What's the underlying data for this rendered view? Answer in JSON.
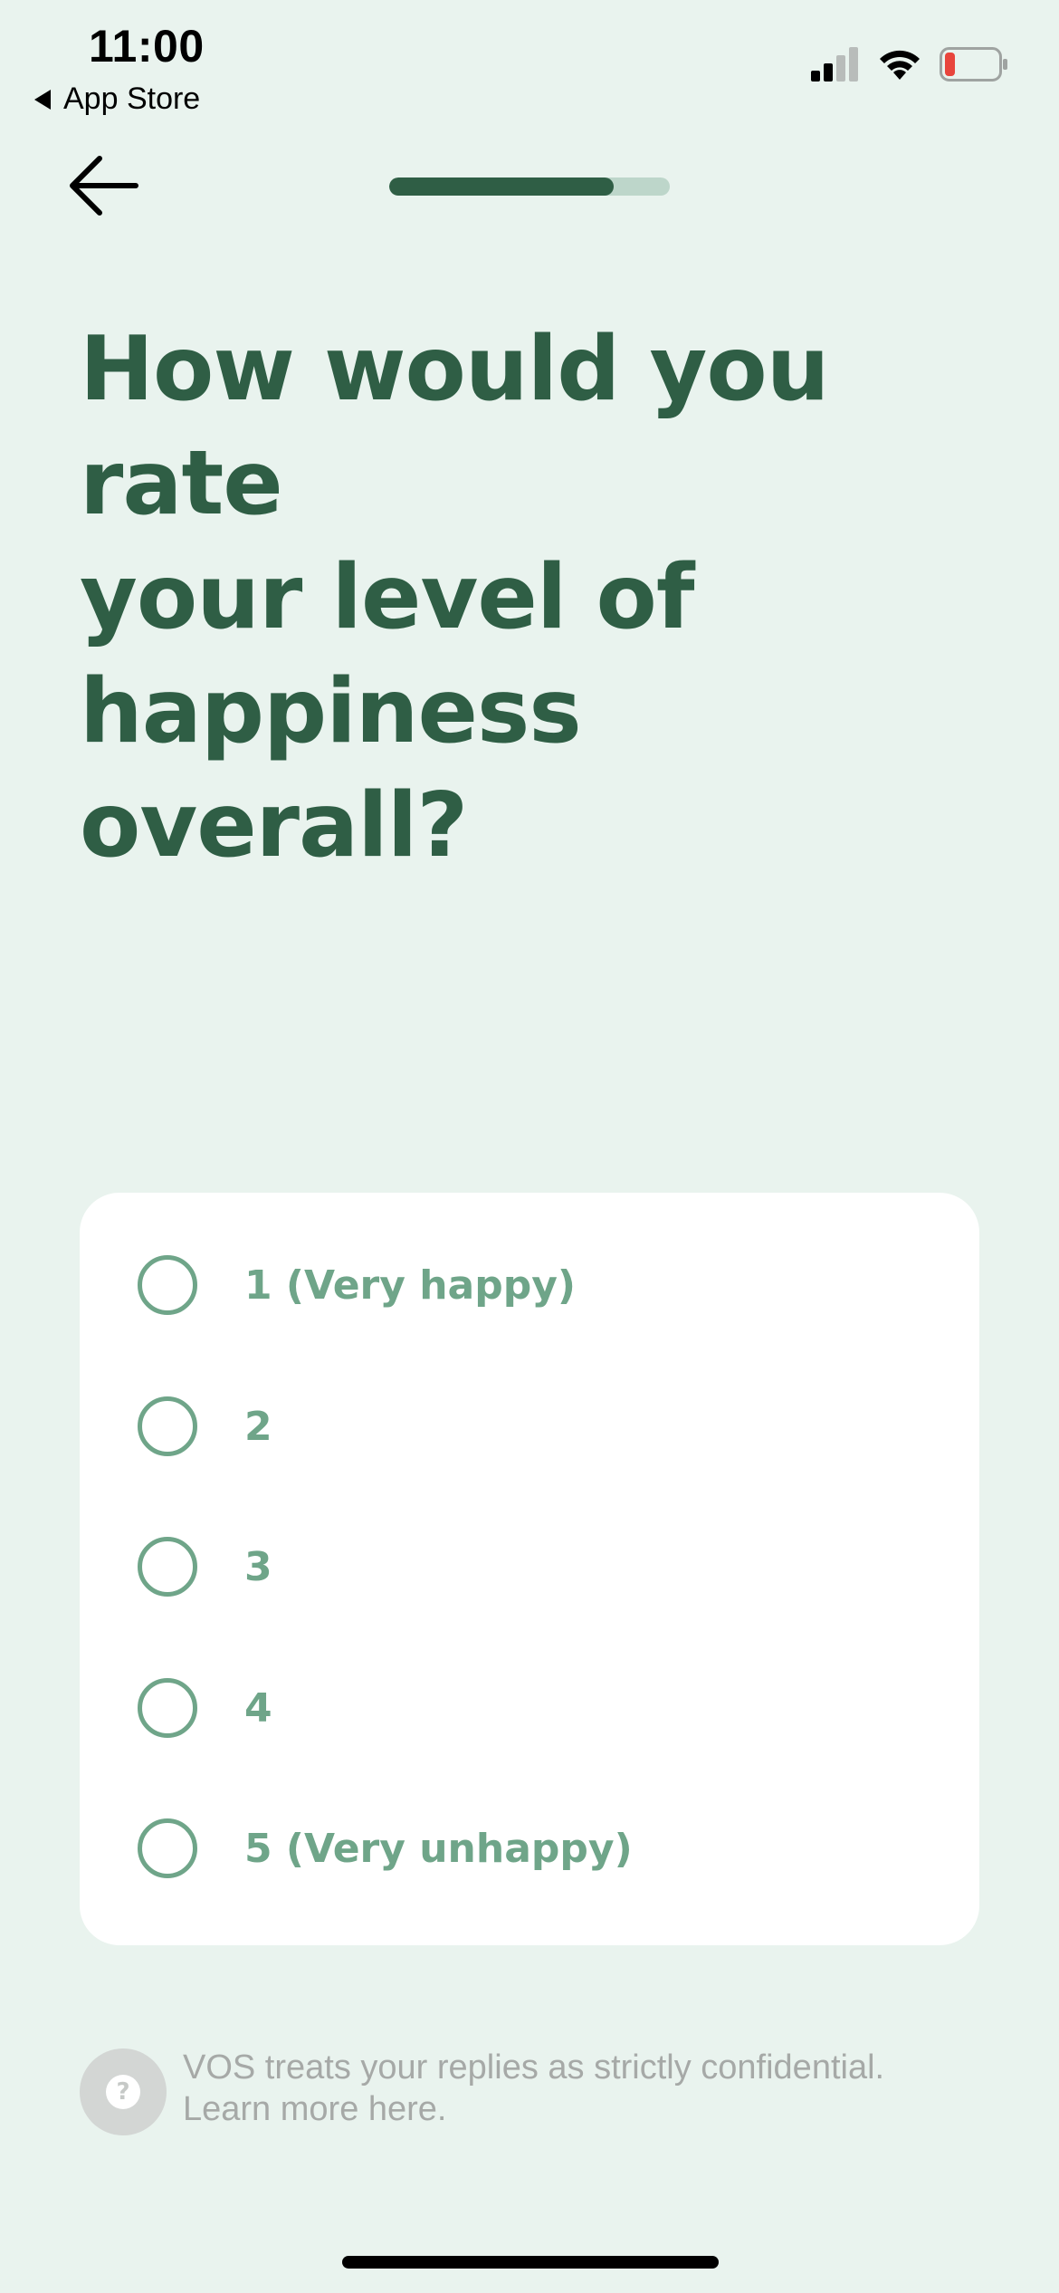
{
  "status_bar": {
    "time": "11:00",
    "back_app": "App Store",
    "battery_color": "#e8453c"
  },
  "progress": {
    "value": 0.8,
    "track_color": "#bdd6ca",
    "fill_color": "#2f5e45"
  },
  "question": {
    "line1": "How would you rate",
    "line2": "your level of",
    "line3": "happiness overall?"
  },
  "options": [
    {
      "label": "1 (Very happy)",
      "selected": false
    },
    {
      "label": "2",
      "selected": false
    },
    {
      "label": "3",
      "selected": false
    },
    {
      "label": "4",
      "selected": false
    },
    {
      "label": "5 (Very unhappy)",
      "selected": false
    }
  ],
  "footer": {
    "help_icon": "question-icon",
    "help_glyph": "?",
    "note_line1": "VOS treats your replies as strictly confidential.",
    "note_line2": "Learn more here."
  },
  "colors": {
    "background": "#e9f3ee",
    "primary": "#2f5e45",
    "option": "#6fa589"
  }
}
